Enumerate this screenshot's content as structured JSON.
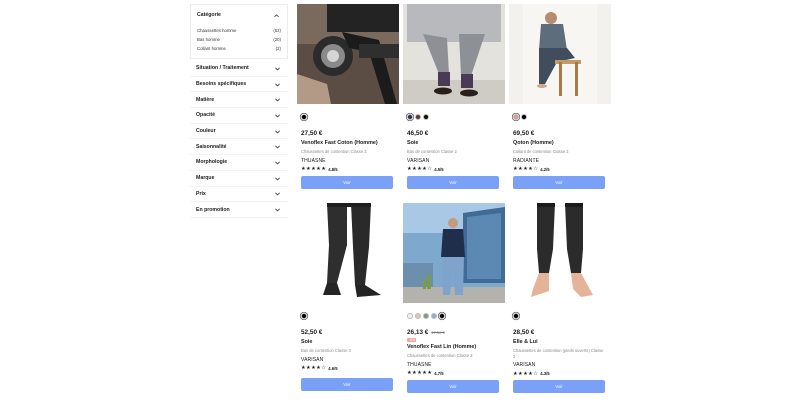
{
  "sidebar": {
    "category": {
      "title": "Catégorie",
      "items": [
        {
          "label": "Chaussettes homme",
          "count": "(62)"
        },
        {
          "label": "Bas homme",
          "count": "(20)"
        },
        {
          "label": "Collant homme",
          "count": "(2)"
        }
      ]
    },
    "facets": [
      {
        "label": "Situation / Traitement"
      },
      {
        "label": "Besoins spécifiques"
      },
      {
        "label": "Matière"
      },
      {
        "label": "Opacité"
      },
      {
        "label": "Couleur"
      },
      {
        "label": "Saisonnalité"
      },
      {
        "label": "Morphologie"
      },
      {
        "label": "Marque"
      },
      {
        "label": "Prix"
      },
      {
        "label": "En promotion"
      }
    ]
  },
  "products": [
    {
      "swatches": [
        "#000000"
      ],
      "price": "27,50 €",
      "old_price": "",
      "promo": "",
      "name": "Venoflex Fast Coton (Homme)",
      "desc": "Chaussettes de contention Classe 3",
      "brand": "THUASNE",
      "stars": "★★★★★",
      "rating": "4.8/5",
      "button": "Voir"
    },
    {
      "swatches": [
        "#3e2b57",
        "#5a3a31",
        "#0d0d0d"
      ],
      "price": "46,50 €",
      "old_price": "",
      "promo": "",
      "name": "Soie",
      "desc": "Bas de contention Classe 2",
      "brand": "VARISAN",
      "stars": "★★★★☆",
      "rating": "4.5/5",
      "button": "Voir"
    },
    {
      "swatches": [
        "#d9a189",
        "#000000"
      ],
      "price": "69,50 €",
      "old_price": "",
      "promo": "",
      "name": "Qoton (Homme)",
      "desc": "Collant de contention Classe 2",
      "brand": "RADIANTE",
      "stars": "★★★★☆",
      "rating": "4.2/5",
      "button": "Voir"
    },
    {
      "swatches": [
        "#000000"
      ],
      "price": "52,50 €",
      "old_price": "",
      "promo": "",
      "name": "Soie",
      "desc": "Bas de contention Classe 3",
      "brand": "VARISAN",
      "stars": "★★★★☆",
      "rating": "4.6/5",
      "button": "Voir"
    },
    {
      "swatches": [
        "#f2f2f2",
        "#d7c9ad",
        "#7f9c6e",
        "#8bb4c6",
        "#000000"
      ],
      "price": "26,13 €",
      "old_price": "27,50 €",
      "promo": "-5%",
      "name": "Venoflex Fast Lin (Homme)",
      "desc": "Chaussettes de contention Classe 2",
      "brand": "THUASNE",
      "stars": "★★★★★",
      "rating": "4.7/5",
      "button": "Voir"
    },
    {
      "swatches": [
        "#000000"
      ],
      "price": "28,50 €",
      "old_price": "",
      "promo": "",
      "name": "Elle & Lui",
      "desc": "Chaussettes de contention (pieds ouverts) Classe 2",
      "brand": "VARISAN",
      "stars": "★★★★☆",
      "rating": "4.3/5",
      "button": "Voir"
    }
  ],
  "colors": {
    "accent": "#7aa0f8",
    "promo": "#f2a39e"
  }
}
